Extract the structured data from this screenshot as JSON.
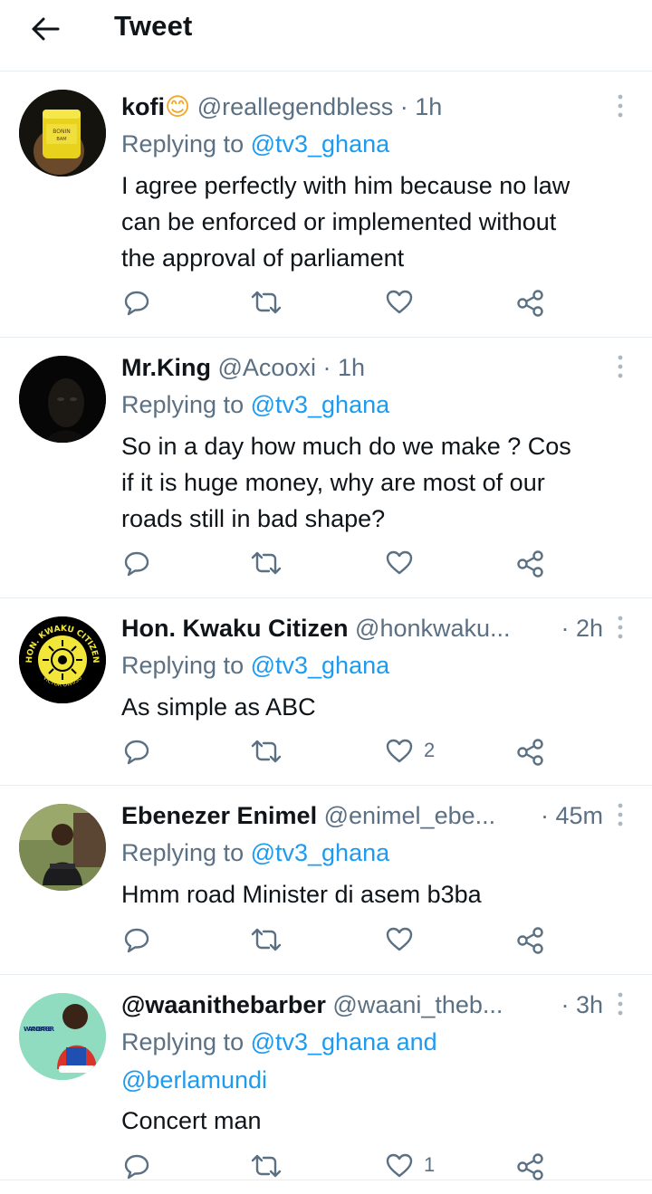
{
  "header": {
    "title": "Tweet"
  },
  "tweets": [
    {
      "name": "kofi",
      "emoji": "😊",
      "handle": "@reallegendbless",
      "time": "· 1h",
      "replying_prefix": "Replying to ",
      "replying_to": "@tv3_ghana",
      "text_lines": [
        "I agree perfectly with him because no law",
        "can be enforced or implemented without",
        "the approval of parliament"
      ],
      "likes": ""
    },
    {
      "name": "Mr.King",
      "handle": "@Acooxi",
      "time": "· 1h",
      "replying_prefix": "Replying to ",
      "replying_to": "@tv3_ghana",
      "text_lines": [
        "So in a day how much do we make ? Cos",
        "if it is huge money,  why are most of our",
        "roads still in bad shape?"
      ],
      "likes": ""
    },
    {
      "name": "Hon. Kwaku Citizen",
      "handle": "@honkwaku...",
      "time": "· 2h",
      "replying_prefix": "Replying to ",
      "replying_to": "@tv3_ghana",
      "text_lines": [
        "As simple as ABC"
      ],
      "likes": "2",
      "avatar_text_top": "HON. KWAKU CITIZEN",
      "avatar_text_bottom": "VICTOR OWUSU"
    },
    {
      "name": "Ebenezer Enimel",
      "handle": "@enimel_ebe...",
      "time": "· 45m",
      "replying_prefix": "Replying to ",
      "replying_to": "@tv3_ghana",
      "text_lines": [
        "Hmm road Minister di asem b3ba"
      ],
      "likes": ""
    },
    {
      "name": "@waanithebarber",
      "handle": "@waani_theb...",
      "time": "· 3h",
      "replying_prefix": "Replying to ",
      "replying_to": "@tv3_ghana and",
      "replying_to_2": "@berlamundi",
      "text_lines": [
        "Concert man"
      ],
      "likes": "1",
      "avatar_text": "WAANI D'BARBER"
    }
  ],
  "colors": {
    "accent": "#1d9bf0",
    "muted": "#5b7083",
    "text": "#0f1419",
    "divider": "#e6ecf0"
  },
  "icons": [
    "back-arrow-icon",
    "more-vertical-icon",
    "reply-icon",
    "retweet-icon",
    "like-icon",
    "share-icon"
  ]
}
